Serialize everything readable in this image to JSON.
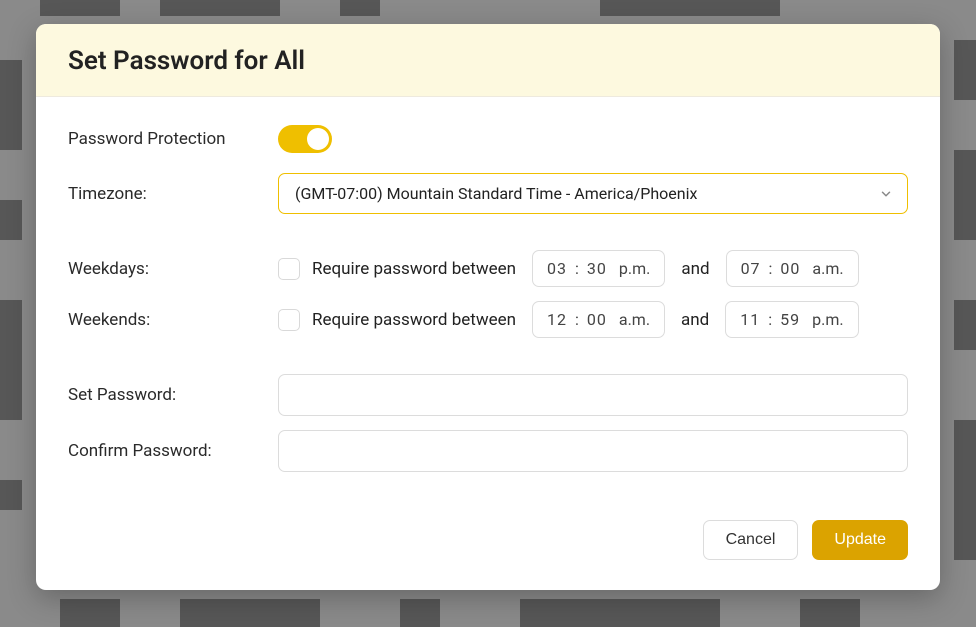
{
  "modal": {
    "title": "Set Password for All",
    "labels": {
      "password_protection": "Password Protection",
      "timezone": "Timezone:",
      "weekdays": "Weekdays:",
      "weekends": "Weekends:",
      "set_password": "Set Password:",
      "confirm_password": "Confirm Password:",
      "require_password_between": "Require password between",
      "and": "and"
    },
    "toggle": {
      "password_protection_on": true
    },
    "timezone": {
      "selected": "(GMT-07:00) Mountain Standard Time - America/Phoenix"
    },
    "weekdays": {
      "checked": false,
      "start": {
        "hh": "03",
        "mm": "30",
        "ampm": "p.m."
      },
      "end": {
        "hh": "07",
        "mm": "00",
        "ampm": "a.m."
      }
    },
    "weekends": {
      "checked": false,
      "start": {
        "hh": "12",
        "mm": "00",
        "ampm": "a.m."
      },
      "end": {
        "hh": "11",
        "mm": "59",
        "ampm": "p.m."
      }
    },
    "set_password_value": "",
    "confirm_password_value": "",
    "buttons": {
      "cancel": "Cancel",
      "update": "Update"
    }
  }
}
